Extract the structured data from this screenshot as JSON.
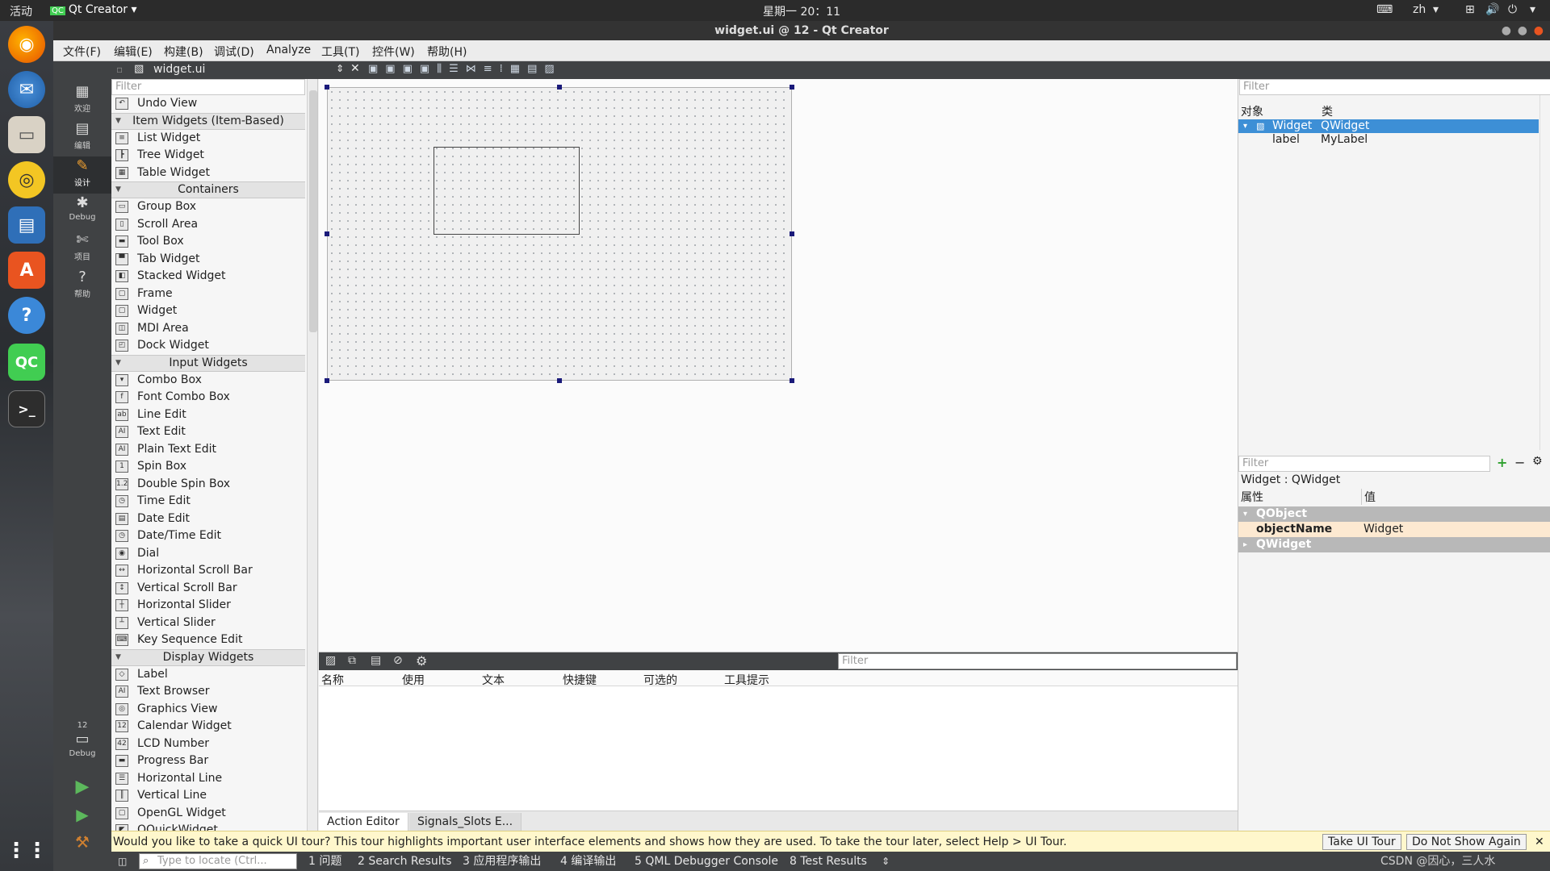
{
  "topbar": {
    "activities": "活动",
    "app_name": "Qt Creator",
    "clock": "星期一 20：11",
    "input_method": "zh"
  },
  "window": {
    "title": "widget.ui @ 12 - Qt Creator"
  },
  "menubar": [
    "文件(F)",
    "编辑(E)",
    "构建(B)",
    "调试(D)",
    "Analyze",
    "工具(T)",
    "控件(W)",
    "帮助(H)"
  ],
  "modes": [
    {
      "label": "欢迎",
      "icon": "grid-icon"
    },
    {
      "label": "编辑",
      "icon": "edit-doc-icon"
    },
    {
      "label": "设计",
      "icon": "pencil-icon"
    },
    {
      "label": "Debug",
      "icon": "bug-icon"
    },
    {
      "label": "项目",
      "icon": "wrench-icon"
    },
    {
      "label": "帮助",
      "icon": "help-icon"
    }
  ],
  "kit": {
    "project": "12",
    "config": "Debug"
  },
  "doc_toolbar": {
    "file": "widget.ui"
  },
  "widgetbox": {
    "filter_placeholder": "Filter",
    "rows": [
      {
        "type": "item",
        "label": "Undo View",
        "icon": "undo-view-icon",
        "glyph": "↶"
      },
      {
        "type": "cat",
        "label": "Item Widgets (Item-Based)"
      },
      {
        "type": "item",
        "label": "List Widget",
        "icon": "list-widget-icon",
        "glyph": "≡"
      },
      {
        "type": "item",
        "label": "Tree Widget",
        "icon": "tree-widget-icon",
        "glyph": "┣"
      },
      {
        "type": "item",
        "label": "Table Widget",
        "icon": "table-widget-icon",
        "glyph": "▦"
      },
      {
        "type": "cat",
        "label": "Containers"
      },
      {
        "type": "item",
        "label": "Group Box",
        "icon": "group-box-icon",
        "glyph": "▭"
      },
      {
        "type": "item",
        "label": "Scroll Area",
        "icon": "scroll-area-icon",
        "glyph": "▯"
      },
      {
        "type": "item",
        "label": "Tool Box",
        "icon": "tool-box-icon",
        "glyph": "▬"
      },
      {
        "type": "item",
        "label": "Tab Widget",
        "icon": "tab-widget-icon",
        "glyph": "▀"
      },
      {
        "type": "item",
        "label": "Stacked Widget",
        "icon": "stacked-widget-icon",
        "glyph": "◧"
      },
      {
        "type": "item",
        "label": "Frame",
        "icon": "frame-icon",
        "glyph": "▢"
      },
      {
        "type": "item",
        "label": "Widget",
        "icon": "widget-icon",
        "glyph": "▢"
      },
      {
        "type": "item",
        "label": "MDI Area",
        "icon": "mdi-area-icon",
        "glyph": "◫"
      },
      {
        "type": "item",
        "label": "Dock Widget",
        "icon": "dock-widget-icon",
        "glyph": "◰"
      },
      {
        "type": "cat",
        "label": "Input Widgets"
      },
      {
        "type": "item",
        "label": "Combo Box",
        "icon": "combo-box-icon",
        "glyph": "▾"
      },
      {
        "type": "item",
        "label": "Font Combo Box",
        "icon": "font-combo-box-icon",
        "glyph": "f"
      },
      {
        "type": "item",
        "label": "Line Edit",
        "icon": "line-edit-icon",
        "glyph": "ab"
      },
      {
        "type": "item",
        "label": "Text Edit",
        "icon": "text-edit-icon",
        "glyph": "AI"
      },
      {
        "type": "item",
        "label": "Plain Text Edit",
        "icon": "plain-text-edit-icon",
        "glyph": "AI"
      },
      {
        "type": "item",
        "label": "Spin Box",
        "icon": "spin-box-icon",
        "glyph": "1"
      },
      {
        "type": "item",
        "label": "Double Spin Box",
        "icon": "double-spin-box-icon",
        "glyph": "1.2"
      },
      {
        "type": "item",
        "label": "Time Edit",
        "icon": "time-edit-icon",
        "glyph": "◷"
      },
      {
        "type": "item",
        "label": "Date Edit",
        "icon": "date-edit-icon",
        "glyph": "▤"
      },
      {
        "type": "item",
        "label": "Date/Time Edit",
        "icon": "date-time-edit-icon",
        "glyph": "◷"
      },
      {
        "type": "item",
        "label": "Dial",
        "icon": "dial-icon",
        "glyph": "◉"
      },
      {
        "type": "item",
        "label": "Horizontal Scroll Bar",
        "icon": "horizontal-scroll-bar-icon",
        "glyph": "↔"
      },
      {
        "type": "item",
        "label": "Vertical Scroll Bar",
        "icon": "vertical-scroll-bar-icon",
        "glyph": "↕"
      },
      {
        "type": "item",
        "label": "Horizontal Slider",
        "icon": "horizontal-slider-icon",
        "glyph": "┼"
      },
      {
        "type": "item",
        "label": "Vertical Slider",
        "icon": "vertical-slider-icon",
        "glyph": "┴"
      },
      {
        "type": "item",
        "label": "Key Sequence Edit",
        "icon": "key-sequence-edit-icon",
        "glyph": "⌨"
      },
      {
        "type": "cat",
        "label": "Display Widgets"
      },
      {
        "type": "item",
        "label": "Label",
        "icon": "label-icon",
        "glyph": "◇"
      },
      {
        "type": "item",
        "label": "Text Browser",
        "icon": "text-browser-icon",
        "glyph": "AI"
      },
      {
        "type": "item",
        "label": "Graphics View",
        "icon": "graphics-view-icon",
        "glyph": "◎"
      },
      {
        "type": "item",
        "label": "Calendar Widget",
        "icon": "calendar-widget-icon",
        "glyph": "12"
      },
      {
        "type": "item",
        "label": "LCD Number",
        "icon": "lcd-number-icon",
        "glyph": "42"
      },
      {
        "type": "item",
        "label": "Progress Bar",
        "icon": "progress-bar-icon",
        "glyph": "▬"
      },
      {
        "type": "item",
        "label": "Horizontal Line",
        "icon": "horizontal-line-icon",
        "glyph": "☰"
      },
      {
        "type": "item",
        "label": "Vertical Line",
        "icon": "vertical-line-icon",
        "glyph": "║"
      },
      {
        "type": "item",
        "label": "OpenGL Widget",
        "icon": "opengl-widget-icon",
        "glyph": "▢"
      },
      {
        "type": "item",
        "label": "QQuickWidget",
        "icon": "qquickwidget-icon",
        "glyph": "◤"
      }
    ]
  },
  "object_inspector": {
    "filter_placeholder": "Filter",
    "col_object": "对象",
    "col_class": "类",
    "rows": [
      {
        "object": "Widget",
        "class": "QWidget",
        "selected": true
      },
      {
        "object": "label",
        "class": "MyLabel",
        "selected": false
      }
    ]
  },
  "property_editor": {
    "filter_placeholder": "Filter",
    "context": "Widget : QWidget",
    "col_property": "属性",
    "col_value": "值",
    "group_qobject": "QObject",
    "prop_name": "objectName",
    "prop_value": "Widget",
    "group_qwidget": "QWidget"
  },
  "action_editor": {
    "filter_placeholder": "Filter",
    "columns": [
      "名称",
      "使用",
      "文本",
      "快捷键",
      "可选的",
      "工具提示"
    ],
    "tabs": [
      "Action Editor",
      "Signals_Slots E..."
    ]
  },
  "notice": {
    "text": "Would you like to take a quick UI tour? This tour highlights important user interface elements and shows how they are used. To take the tour later, select Help > UI Tour.",
    "take_tour": "Take UI Tour",
    "dont_show": "Do Not Show Again"
  },
  "statusbar": {
    "locate_placeholder": "Type to locate (Ctrl...",
    "panes": [
      "1 问题",
      "2 Search Results",
      "3 应用程序输出",
      "4 编译输出",
      "5 QML Debugger Console",
      "8 Test Results"
    ]
  },
  "watermark": "CSDN @因心，三人水"
}
